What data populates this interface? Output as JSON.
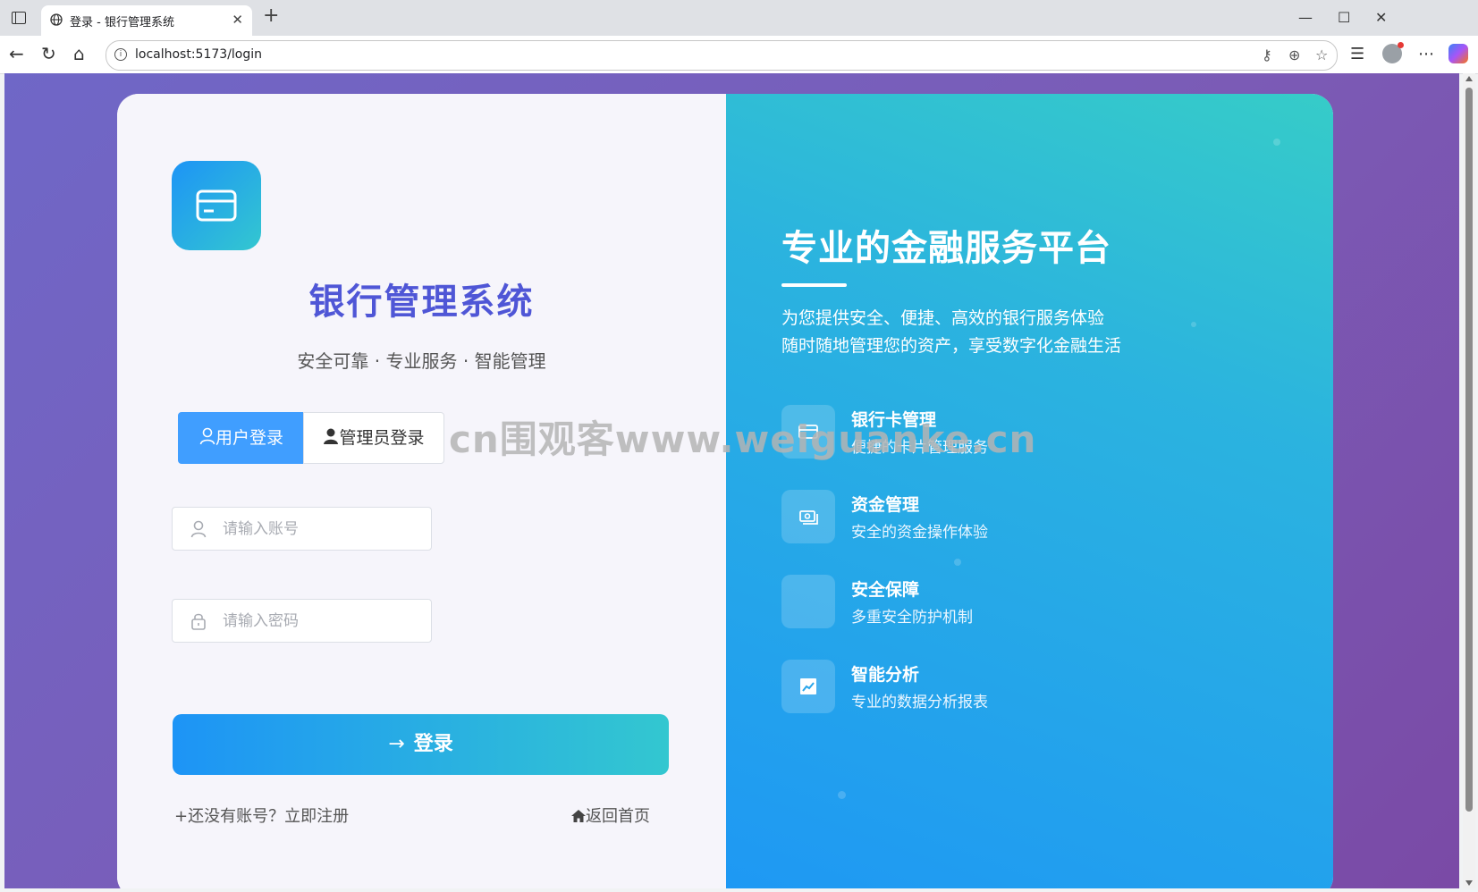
{
  "browser": {
    "tab_title": "登录 - 银行管理系统",
    "tab_close": "✕",
    "new_tab": "+",
    "url": "localhost:5173/login",
    "window_controls": [
      "—",
      "☐",
      "✕"
    ]
  },
  "login": {
    "system_title": "银行管理系统",
    "subtitle": "安全可靠 · 专业服务 · 智能管理",
    "tabs": [
      {
        "label": "用户登录",
        "active": true
      },
      {
        "label": "管理员登录",
        "active": false
      }
    ],
    "account_placeholder": "请输入账号",
    "password_placeholder": "请输入密码",
    "login_button": "登录",
    "register_link": "还没有账号？立即注册",
    "home_link": "返回首页"
  },
  "promo": {
    "title": "专业的金融服务平台",
    "desc_line1": "为您提供安全、便捷、高效的银行服务体验",
    "desc_line2": "随时随地管理您的资产，享受数字化金融生活",
    "features": [
      {
        "title": "银行卡管理",
        "desc": "便捷的卡片管理服务",
        "icon": "card-icon"
      },
      {
        "title": "资金管理",
        "desc": "安全的资金操作体验",
        "icon": "money-icon"
      },
      {
        "title": "安全保障",
        "desc": "多重安全防护机制",
        "icon": "shield-icon"
      },
      {
        "title": "智能分析",
        "desc": "专业的数据分析报表",
        "icon": "chart-icon"
      }
    ]
  },
  "watermark": "cn围观客www.weiguanke.cn",
  "colors": {
    "accent_blue": "#409eff",
    "title_purple": "#4f56d6",
    "gradient_start": "#1d94f6",
    "gradient_end": "#33c7d0"
  }
}
